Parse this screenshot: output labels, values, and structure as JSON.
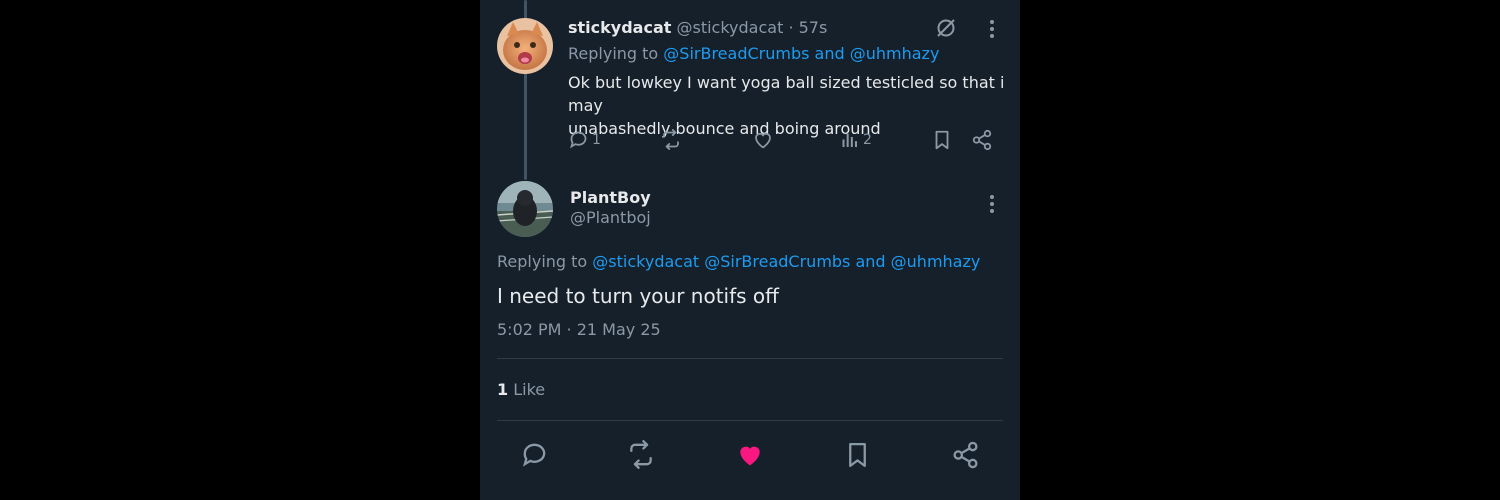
{
  "reply_tweet": {
    "display_name": "stickydacat",
    "handle": "@stickydacat",
    "time_ago": "· 57s",
    "replying_prefix": "Replying to",
    "replying_to": "@SirBreadCrumbs and @uhmhazy",
    "text_line1": "Ok but lowkey I want yoga ball sized testicled so that i may",
    "text_line2": "unabashedly bounce and boing around",
    "reply_count": "1",
    "view_count": "2",
    "icons": [
      "reply-icon",
      "retweet-icon",
      "like-icon",
      "views-icon",
      "bookmark-icon",
      "share-icon",
      "grok-icon",
      "more-icon"
    ]
  },
  "main_tweet": {
    "display_name": "PlantBoy",
    "handle": "@Plantboj",
    "replying_prefix": "Replying to",
    "replying_to": "@stickydacat @SirBreadCrumbs and @uhmhazy",
    "text": "I need to turn your notifs off",
    "timestamp": "5:02 PM · 21 May 25",
    "like_count": "1",
    "like_label": "Like",
    "liked": true,
    "icons": [
      "reply-icon",
      "retweet-icon",
      "like-icon",
      "bookmark-icon",
      "share-icon",
      "more-icon"
    ]
  },
  "colors": {
    "background": "#15202b",
    "link": "#1d9bf0",
    "like_active": "#f91880",
    "muted": "#8b98a5"
  }
}
